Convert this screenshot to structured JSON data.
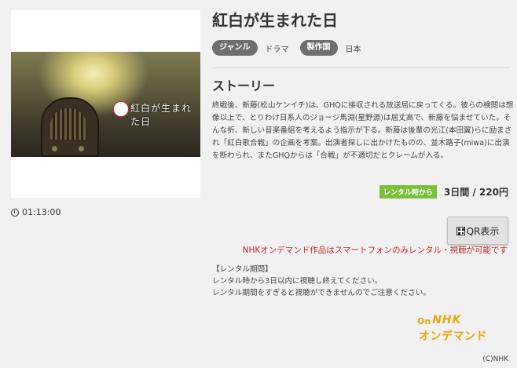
{
  "program": {
    "title": "紅白が生まれた日",
    "thumbnail_title": "紅白が生まれた日",
    "duration": "01:13:00"
  },
  "tags": {
    "genre_label": "ジャンル",
    "genre_value": "ドラマ",
    "country_label": "製作国",
    "country_value": "日本"
  },
  "story": {
    "heading": "ストーリー",
    "text": "終戦後、新藤(松山ケンイチ)は、GHQに接収される放送局に戻ってくる。彼らの検閲は想像以上で、とりわけ日系人のジョージ馬淵(星野源)は居丈高で、新藤を悩ませていた。そんな折、新しい音楽番組を考えるよう指示が下る。新藤は後輩の光江(本田翼)らに励まされ「紅白歌合戦」の企画を考案。出演者探しに出かけたものの、並木路子(miwa)に出演を断わられ、またGHQからは「合戦」が不適切だとクレームが入る。"
  },
  "rental": {
    "badge": "レンタル時から",
    "price": "3日間 / 220円"
  },
  "qr_button": {
    "label": "QR表示",
    "icon": "qr-code-icon"
  },
  "notice": "NHKオンデマンド作品はスマートフォンのみレンタル・視聴が可能です",
  "period": {
    "heading": "【レンタル期間】",
    "line1": "レンタル時から3日以内に視聴し終えてください。",
    "line2": "レンタル期間をすぎると視聴ができませんのでご注意ください。"
  },
  "nhk_logo": {
    "top": "NHK",
    "bottom": "オンデマンド"
  },
  "copyright": "(C)NHK",
  "colors": {
    "background": "#f1f1f1",
    "pill": "#6f6f6f",
    "rental_badge": "#7bbf3a",
    "notice": "#c0282d",
    "nhk_orange": "#e9a60a"
  }
}
